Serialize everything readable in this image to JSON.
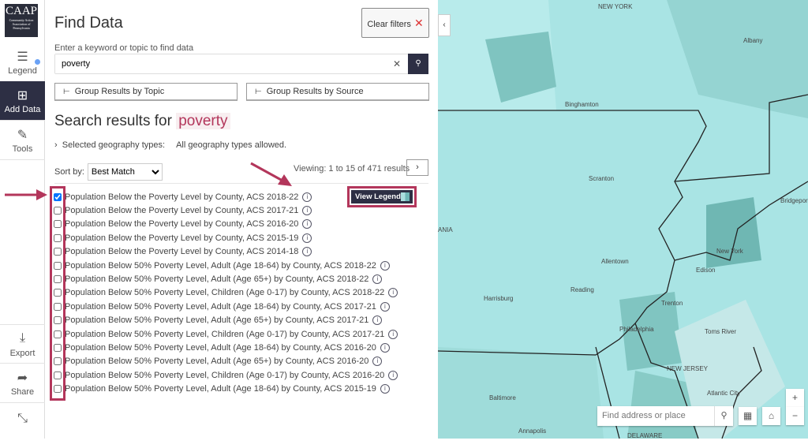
{
  "rail": {
    "logo": "CAAP",
    "logo_sub": "Community Action Association of Pennsylvania",
    "items": [
      {
        "label": "Legend",
        "icon": "list-icon"
      },
      {
        "label": "Add Data",
        "icon": "add-file-icon"
      },
      {
        "label": "Tools",
        "icon": "tools-icon"
      },
      {
        "label": "Export",
        "icon": "download-icon"
      },
      {
        "label": "Share",
        "icon": "share-icon"
      }
    ]
  },
  "panel": {
    "title": "Find Data",
    "clear_filters": "Clear filters",
    "search_label": "Enter a keyword or topic to find data",
    "search_value": "poverty",
    "group_topic": "Group Results by Topic",
    "group_source": "Group Results by Source",
    "results_prefix": "Search results for",
    "results_keyword": "poverty",
    "geo_label": "Selected geography types:",
    "geo_value": "All geography types allowed.",
    "sort_label": "Sort by:",
    "sort_value": "Best Match",
    "viewing": "Viewing: 1 to 15 of 471 results",
    "view_legend": "View Legend",
    "results": [
      {
        "label": "Population Below the Poverty Level by County, ACS 2018-22",
        "checked": true
      },
      {
        "label": "Population Below the Poverty Level by County, ACS 2017-21",
        "checked": false
      },
      {
        "label": "Population Below the Poverty Level by County, ACS 2016-20",
        "checked": false
      },
      {
        "label": "Population Below the Poverty Level by County, ACS 2015-19",
        "checked": false
      },
      {
        "label": "Population Below the Poverty Level by County, ACS 2014-18",
        "checked": false
      },
      {
        "label": "Population Below 50% Poverty Level, Adult (Age 18-64) by County, ACS 2018-22",
        "checked": false
      },
      {
        "label": "Population Below 50% Poverty Level, Adult (Age 65+) by County, ACS 2018-22",
        "checked": false
      },
      {
        "label": "Population Below 50% Poverty Level, Children (Age 0-17) by County, ACS 2018-22",
        "checked": false
      },
      {
        "label": "Population Below 50% Poverty Level, Adult (Age 18-64) by County, ACS 2017-21",
        "checked": false
      },
      {
        "label": "Population Below 50% Poverty Level, Adult (Age 65+) by County, ACS 2017-21",
        "checked": false
      },
      {
        "label": "Population Below 50% Poverty Level, Children (Age 0-17) by County, ACS 2017-21",
        "checked": false
      },
      {
        "label": "Population Below 50% Poverty Level, Adult (Age 18-64) by County, ACS 2016-20",
        "checked": false
      },
      {
        "label": "Population Below 50% Poverty Level, Adult (Age 65+) by County, ACS 2016-20",
        "checked": false
      },
      {
        "label": "Population Below 50% Poverty Level, Children (Age 0-17) by County, ACS 2016-20",
        "checked": false
      },
      {
        "label": "Population Below 50% Poverty Level, Adult (Age 18-64) by County, ACS 2015-19",
        "checked": false
      }
    ]
  },
  "map": {
    "search_placeholder": "Find address or place",
    "zoom_in": "+",
    "zoom_out": "−",
    "labels": [
      "NEW YORK",
      "Albany",
      "Binghamton",
      "Scranton",
      "Bridgeport",
      "New York",
      "Allentown",
      "Edison",
      "Harrisburg",
      "Reading",
      "Trenton",
      "Philadelphia",
      "Toms River",
      "NEW JERSEY",
      "Atlantic City",
      "Baltimore",
      "Annapolis",
      "DELAWARE",
      "ANIA"
    ]
  },
  "colors": {
    "accent": "#b3365b",
    "dark": "#2d2f44",
    "map_fill": "#a9e4e4"
  }
}
